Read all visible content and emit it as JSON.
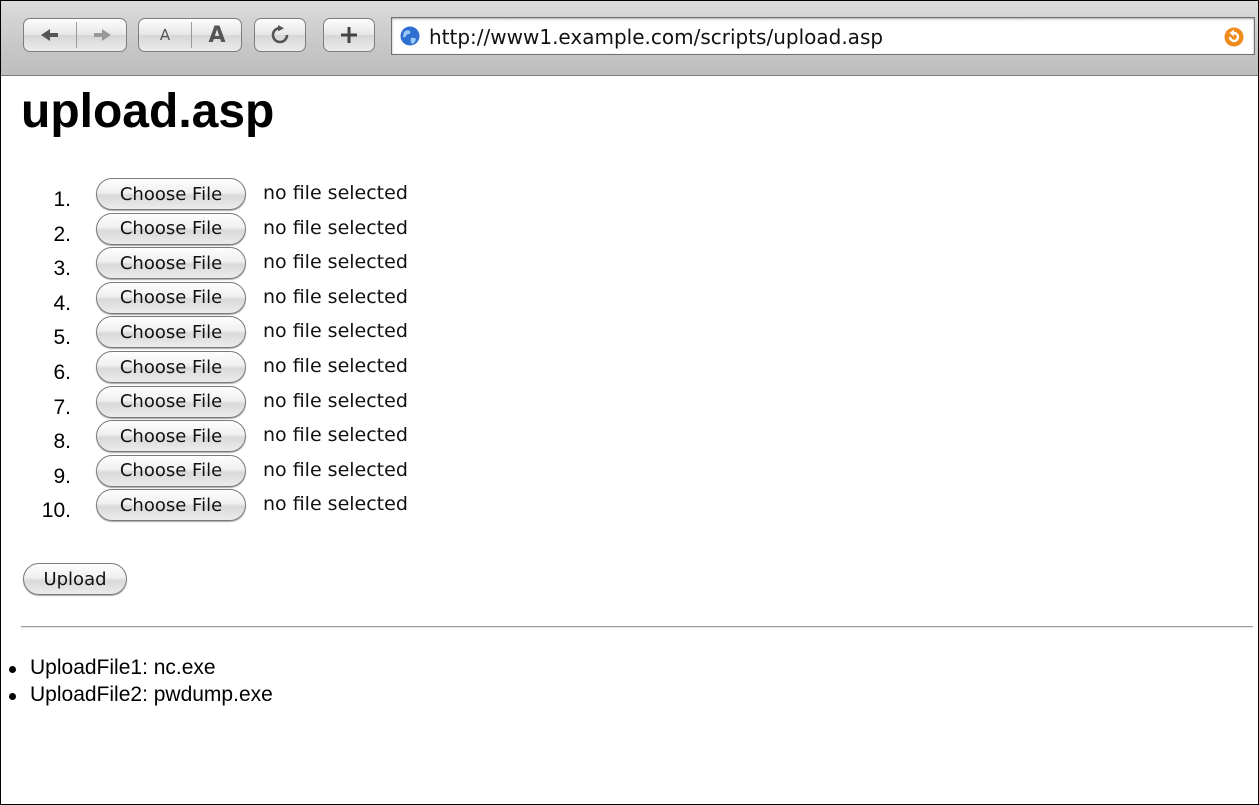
{
  "browser": {
    "url": "http://www1.example.com/scripts/upload.asp",
    "buttons": {
      "back_icon": "back-arrow-icon",
      "forward_icon": "forward-arrow-icon",
      "text_smaller": "A",
      "text_larger": "A",
      "reload_icon": "reload-icon",
      "add_icon": "plus-icon"
    }
  },
  "page": {
    "title": "upload.asp",
    "file_inputs": [
      {
        "number": "1.",
        "button": "Choose File",
        "status": "no file selected"
      },
      {
        "number": "2.",
        "button": "Choose File",
        "status": "no file selected"
      },
      {
        "number": "3.",
        "button": "Choose File",
        "status": "no file selected"
      },
      {
        "number": "4.",
        "button": "Choose File",
        "status": "no file selected"
      },
      {
        "number": "5.",
        "button": "Choose File",
        "status": "no file selected"
      },
      {
        "number": "6.",
        "button": "Choose File",
        "status": "no file selected"
      },
      {
        "number": "7.",
        "button": "Choose File",
        "status": "no file selected"
      },
      {
        "number": "8.",
        "button": "Choose File",
        "status": "no file selected"
      },
      {
        "number": "9.",
        "button": "Choose File",
        "status": "no file selected"
      },
      {
        "number": "10.",
        "button": "Choose File",
        "status": "no file selected"
      }
    ],
    "upload_button": "Upload",
    "results": [
      "UploadFile1: nc.exe",
      "UploadFile2: pwdump.exe"
    ]
  }
}
